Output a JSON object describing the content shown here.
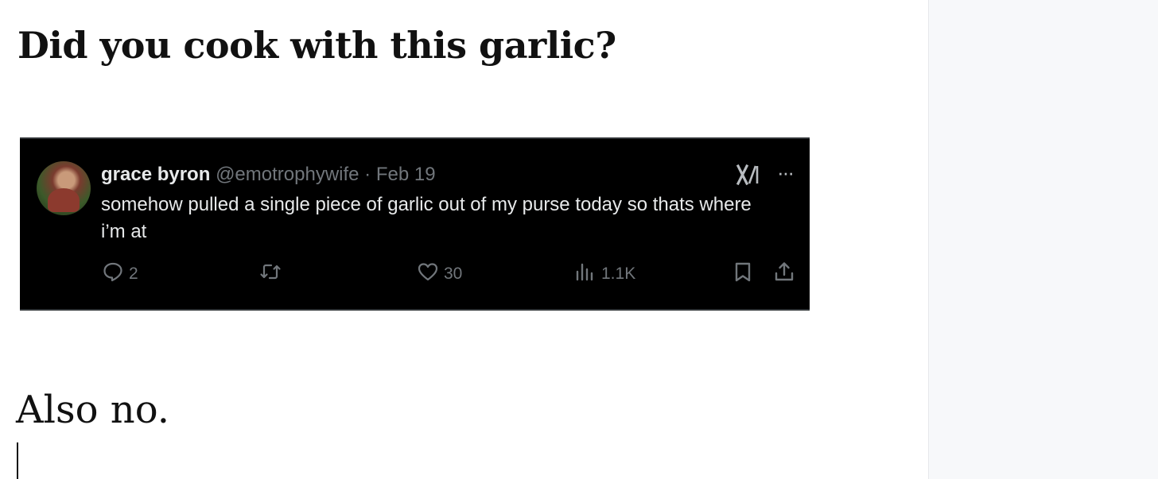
{
  "article": {
    "heading": "Did you cook with this garlic?",
    "paragraph": "Also no."
  },
  "tweet": {
    "author": "grace byron",
    "handle": "@emotrophywife",
    "separator": " · ",
    "date": "Feb 19",
    "text": "somehow pulled a single piece of garlic out of my purse today so thats where i’m at",
    "replies": "2",
    "likes": "30",
    "views": "1.1K",
    "more_glyph": "···",
    "colors": {
      "background": "#000000",
      "text": "#e7e9ea",
      "muted": "#71767b"
    },
    "icons": [
      "avatar",
      "x-logo-icon",
      "more-icon",
      "reply-icon",
      "retweet-icon",
      "like-icon",
      "views-icon",
      "bookmark-icon",
      "share-icon"
    ]
  }
}
